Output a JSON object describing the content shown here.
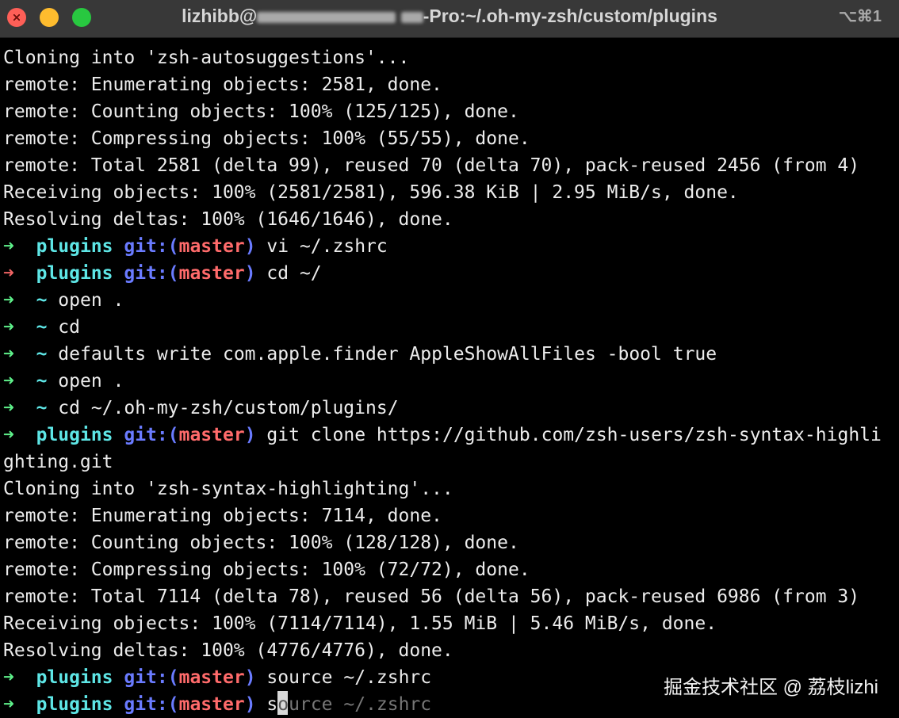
{
  "window": {
    "title_prefix": "lizhibb@",
    "title_suffix": "-Pro:~/.oh-my-zsh/custom/plugins",
    "shortcut": "⌥⌘1"
  },
  "terminal": {
    "output_top": [
      "Cloning into 'zsh-autosuggestions'...",
      "remote: Enumerating objects: 2581, done.",
      "remote: Counting objects: 100% (125/125), done.",
      "remote: Compressing objects: 100% (55/55), done.",
      "remote: Total 2581 (delta 99), reused 70 (delta 70), pack-reused 2456 (from 4)",
      "Receiving objects: 100% (2581/2581), 596.38 KiB | 2.95 MiB/s, done.",
      "Resolving deltas: 100% (1646/1646), done."
    ],
    "prompt_arrow": "➜",
    "git_label": "git:(",
    "git_close": ")",
    "branch": "master",
    "prompts": [
      {
        "dir": "plugins",
        "git": true,
        "status": "ok",
        "cmd": "vi ~/.zshrc"
      },
      {
        "dir": "plugins",
        "git": true,
        "status": "err",
        "cmd": "cd ~/"
      },
      {
        "dir": "~",
        "git": false,
        "status": "ok",
        "cmd": "open ."
      },
      {
        "dir": "~",
        "git": false,
        "status": "ok",
        "cmd": "cd"
      },
      {
        "dir": "~",
        "git": false,
        "status": "ok",
        "cmd": "defaults write com.apple.finder AppleShowAllFiles -bool true"
      },
      {
        "dir": "~",
        "git": false,
        "status": "ok",
        "cmd": "open ."
      },
      {
        "dir": "~",
        "git": false,
        "status": "ok",
        "cmd": "cd ~/.oh-my-zsh/custom/plugins/"
      },
      {
        "dir": "plugins",
        "git": true,
        "status": "ok",
        "cmd": "git clone https://github.com/zsh-users/zsh-syntax-highli"
      }
    ],
    "wrap_line": "ghting.git",
    "output_bottom": [
      "Cloning into 'zsh-syntax-highlighting'...",
      "remote: Enumerating objects: 7114, done.",
      "remote: Counting objects: 100% (128/128), done.",
      "remote: Compressing objects: 100% (72/72), done.",
      "remote: Total 7114 (delta 78), reused 56 (delta 56), pack-reused 6986 (from 3)",
      "Receiving objects: 100% (7114/7114), 1.55 MiB | 5.46 MiB/s, done.",
      "Resolving deltas: 100% (4776/4776), done."
    ],
    "last_prompt": {
      "dir": "plugins",
      "cmd": "source ~/.zshrc"
    },
    "current_prompt": {
      "dir": "plugins",
      "typed_before": "s",
      "typed_under_cursor": "o",
      "suggestion": "urce ~/.zshrc"
    }
  },
  "watermark": "掘金技术社区 @ 荔枝lizhi",
  "colors": {
    "arrow_ok": "#5ef08a",
    "arrow_err": "#f06464",
    "dir": "#5ee6e6",
    "git": "#6a7bff",
    "branch": "#ff6b6b"
  }
}
